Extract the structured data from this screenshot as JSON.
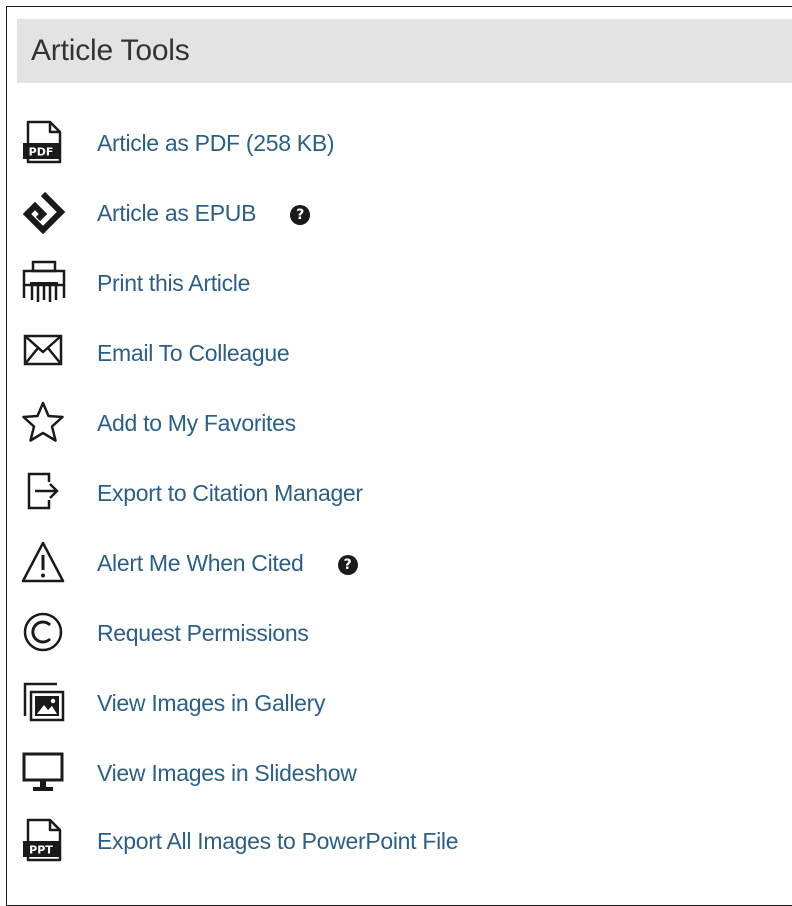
{
  "panel": {
    "title": "Article Tools"
  },
  "tools": [
    {
      "label": "Article as PDF (258 KB)",
      "icon": "pdf-file-icon",
      "icon_text": "PDF"
    },
    {
      "label": "Article as EPUB",
      "icon": "epub-icon",
      "help_glyph": "?"
    },
    {
      "label": "Print this Article",
      "icon": "printer-icon"
    },
    {
      "label": "Email To Colleague",
      "icon": "envelope-icon"
    },
    {
      "label": "Add to My Favorites",
      "icon": "star-icon"
    },
    {
      "label": "Export to Citation Manager",
      "icon": "export-icon"
    },
    {
      "label": "Alert Me When Cited",
      "icon": "warning-icon",
      "help_glyph": "?"
    },
    {
      "label": "Request Permissions",
      "icon": "copyright-icon"
    },
    {
      "label": "View Images in Gallery",
      "icon": "image-gallery-icon"
    },
    {
      "label": "View Images in Slideshow",
      "icon": "monitor-icon"
    },
    {
      "label": "Export All Images to PowerPoint File",
      "icon": "ppt-file-icon",
      "icon_text": "PPT"
    }
  ],
  "colors": {
    "link": "#2b5f88",
    "header_bg": "#e3e3e3",
    "title_text": "#333333",
    "icon": "#1a1a1a"
  }
}
